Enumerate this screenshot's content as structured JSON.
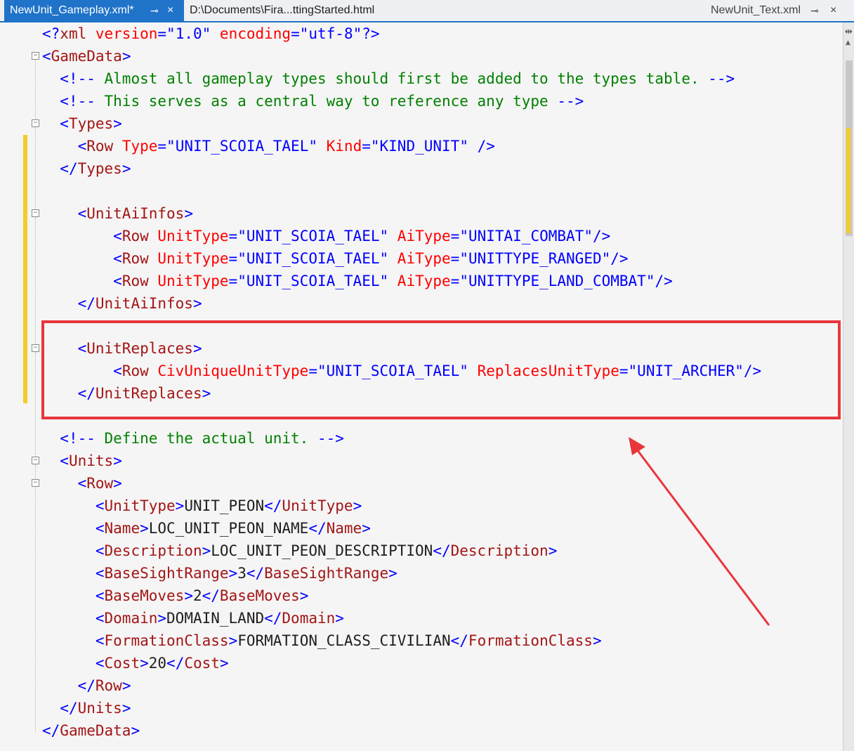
{
  "tabs": {
    "active": "NewUnit_Gameplay.xml*",
    "pin_icon": "⊸",
    "close_icon": "×",
    "second": "D:\\Documents\\Fira...ttingStarted.html",
    "right": "NewUnit_Text.xml"
  },
  "code": {
    "lines": [
      [
        [
          "p",
          "<?"
        ],
        [
          "t",
          "xml"
        ],
        [
          "a",
          " version"
        ],
        [
          "p",
          "=\""
        ],
        [
          "v",
          "1.0"
        ],
        [
          "p",
          "\""
        ],
        [
          "a",
          " encoding"
        ],
        [
          "p",
          "=\""
        ],
        [
          "v",
          "utf-8"
        ],
        [
          "p",
          "\"?>"
        ]
      ],
      [
        [
          "p",
          "<"
        ],
        [
          "t",
          "GameData"
        ],
        [
          "p",
          ">"
        ]
      ],
      [
        [
          "x",
          "  "
        ],
        [
          "p",
          "<!--"
        ],
        [
          "c",
          " Almost all gameplay types should first be added to the types table. "
        ],
        [
          "p",
          "-->"
        ]
      ],
      [
        [
          "x",
          "  "
        ],
        [
          "p",
          "<!--"
        ],
        [
          "c",
          " This serves as a central way to reference any type "
        ],
        [
          "p",
          "-->"
        ]
      ],
      [
        [
          "x",
          "  "
        ],
        [
          "p",
          "<"
        ],
        [
          "t",
          "Types"
        ],
        [
          "p",
          ">"
        ]
      ],
      [
        [
          "x",
          "    "
        ],
        [
          "p",
          "<"
        ],
        [
          "t",
          "Row"
        ],
        [
          "a",
          " Type"
        ],
        [
          "p",
          "=\""
        ],
        [
          "v",
          "UNIT_SCOIA_TAEL"
        ],
        [
          "p",
          "\""
        ],
        [
          "a",
          " Kind"
        ],
        [
          "p",
          "=\""
        ],
        [
          "v",
          "KIND_UNIT"
        ],
        [
          "p",
          "\" />"
        ]
      ],
      [
        [
          "x",
          "  "
        ],
        [
          "p",
          "</"
        ],
        [
          "t",
          "Types"
        ],
        [
          "p",
          ">"
        ]
      ],
      [],
      [
        [
          "x",
          "    "
        ],
        [
          "p",
          "<"
        ],
        [
          "t",
          "UnitAiInfos"
        ],
        [
          "p",
          ">"
        ]
      ],
      [
        [
          "x",
          "        "
        ],
        [
          "p",
          "<"
        ],
        [
          "t",
          "Row"
        ],
        [
          "a",
          " UnitType"
        ],
        [
          "p",
          "=\""
        ],
        [
          "v",
          "UNIT_SCOIA_TAEL"
        ],
        [
          "p",
          "\""
        ],
        [
          "a",
          " AiType"
        ],
        [
          "p",
          "=\""
        ],
        [
          "v",
          "UNITAI_COMBAT"
        ],
        [
          "p",
          "\"/>"
        ]
      ],
      [
        [
          "x",
          "        "
        ],
        [
          "p",
          "<"
        ],
        [
          "t",
          "Row"
        ],
        [
          "a",
          " UnitType"
        ],
        [
          "p",
          "=\""
        ],
        [
          "v",
          "UNIT_SCOIA_TAEL"
        ],
        [
          "p",
          "\""
        ],
        [
          "a",
          " AiType"
        ],
        [
          "p",
          "=\""
        ],
        [
          "v",
          "UNITTYPE_RANGED"
        ],
        [
          "p",
          "\"/>"
        ]
      ],
      [
        [
          "x",
          "        "
        ],
        [
          "p",
          "<"
        ],
        [
          "t",
          "Row"
        ],
        [
          "a",
          " UnitType"
        ],
        [
          "p",
          "=\""
        ],
        [
          "v",
          "UNIT_SCOIA_TAEL"
        ],
        [
          "p",
          "\""
        ],
        [
          "a",
          " AiType"
        ],
        [
          "p",
          "=\""
        ],
        [
          "v",
          "UNITTYPE_LAND_COMBAT"
        ],
        [
          "p",
          "\"/>"
        ]
      ],
      [
        [
          "x",
          "    "
        ],
        [
          "p",
          "</"
        ],
        [
          "t",
          "UnitAiInfos"
        ],
        [
          "p",
          ">"
        ]
      ],
      [],
      [
        [
          "x",
          "    "
        ],
        [
          "p",
          "<"
        ],
        [
          "t",
          "UnitReplaces"
        ],
        [
          "p",
          ">"
        ]
      ],
      [
        [
          "x",
          "        "
        ],
        [
          "p",
          "<"
        ],
        [
          "t",
          "Row"
        ],
        [
          "a",
          " CivUniqueUnitType"
        ],
        [
          "p",
          "=\""
        ],
        [
          "v",
          "UNIT_SCOIA_TAEL"
        ],
        [
          "p",
          "\""
        ],
        [
          "a",
          " ReplacesUnitType"
        ],
        [
          "p",
          "=\""
        ],
        [
          "v",
          "UNIT_ARCHER"
        ],
        [
          "p",
          "\"/>"
        ]
      ],
      [
        [
          "x",
          "    "
        ],
        [
          "p",
          "</"
        ],
        [
          "t",
          "UnitReplaces"
        ],
        [
          "p",
          ">"
        ]
      ],
      [],
      [
        [
          "x",
          "  "
        ],
        [
          "p",
          "<!--"
        ],
        [
          "c",
          " Define the actual unit. "
        ],
        [
          "p",
          "-->"
        ]
      ],
      [
        [
          "x",
          "  "
        ],
        [
          "p",
          "<"
        ],
        [
          "t",
          "Units"
        ],
        [
          "p",
          ">"
        ]
      ],
      [
        [
          "x",
          "    "
        ],
        [
          "p",
          "<"
        ],
        [
          "t",
          "Row"
        ],
        [
          "p",
          ">"
        ]
      ],
      [
        [
          "x",
          "      "
        ],
        [
          "p",
          "<"
        ],
        [
          "t",
          "UnitType"
        ],
        [
          "p",
          ">"
        ],
        [
          "x",
          "UNIT_PEON"
        ],
        [
          "p",
          "</"
        ],
        [
          "t",
          "UnitType"
        ],
        [
          "p",
          ">"
        ]
      ],
      [
        [
          "x",
          "      "
        ],
        [
          "p",
          "<"
        ],
        [
          "t",
          "Name"
        ],
        [
          "p",
          ">"
        ],
        [
          "x",
          "LOC_UNIT_PEON_NAME"
        ],
        [
          "p",
          "</"
        ],
        [
          "t",
          "Name"
        ],
        [
          "p",
          ">"
        ]
      ],
      [
        [
          "x",
          "      "
        ],
        [
          "p",
          "<"
        ],
        [
          "t",
          "Description"
        ],
        [
          "p",
          ">"
        ],
        [
          "x",
          "LOC_UNIT_PEON_DESCRIPTION"
        ],
        [
          "p",
          "</"
        ],
        [
          "t",
          "Description"
        ],
        [
          "p",
          ">"
        ]
      ],
      [
        [
          "x",
          "      "
        ],
        [
          "p",
          "<"
        ],
        [
          "t",
          "BaseSightRange"
        ],
        [
          "p",
          ">"
        ],
        [
          "x",
          "3"
        ],
        [
          "p",
          "</"
        ],
        [
          "t",
          "BaseSightRange"
        ],
        [
          "p",
          ">"
        ]
      ],
      [
        [
          "x",
          "      "
        ],
        [
          "p",
          "<"
        ],
        [
          "t",
          "BaseMoves"
        ],
        [
          "p",
          ">"
        ],
        [
          "x",
          "2"
        ],
        [
          "p",
          "</"
        ],
        [
          "t",
          "BaseMoves"
        ],
        [
          "p",
          ">"
        ]
      ],
      [
        [
          "x",
          "      "
        ],
        [
          "p",
          "<"
        ],
        [
          "t",
          "Domain"
        ],
        [
          "p",
          ">"
        ],
        [
          "x",
          "DOMAIN_LAND"
        ],
        [
          "p",
          "</"
        ],
        [
          "t",
          "Domain"
        ],
        [
          "p",
          ">"
        ]
      ],
      [
        [
          "x",
          "      "
        ],
        [
          "p",
          "<"
        ],
        [
          "t",
          "FormationClass"
        ],
        [
          "p",
          ">"
        ],
        [
          "x",
          "FORMATION_CLASS_CIVILIAN"
        ],
        [
          "p",
          "</"
        ],
        [
          "t",
          "FormationClass"
        ],
        [
          "p",
          ">"
        ]
      ],
      [
        [
          "x",
          "      "
        ],
        [
          "p",
          "<"
        ],
        [
          "t",
          "Cost"
        ],
        [
          "p",
          ">"
        ],
        [
          "x",
          "20"
        ],
        [
          "p",
          "</"
        ],
        [
          "t",
          "Cost"
        ],
        [
          "p",
          ">"
        ]
      ],
      [
        [
          "x",
          "    "
        ],
        [
          "p",
          "</"
        ],
        [
          "t",
          "Row"
        ],
        [
          "p",
          ">"
        ]
      ],
      [
        [
          "x",
          "  "
        ],
        [
          "p",
          "</"
        ],
        [
          "t",
          "Units"
        ],
        [
          "p",
          ">"
        ]
      ],
      [
        [
          "p",
          "</"
        ],
        [
          "t",
          "GameData"
        ],
        [
          "p",
          ">"
        ]
      ]
    ]
  },
  "colors": {
    "tag": "#a31515",
    "punct": "#0000ff",
    "attr": "#ff0000",
    "value": "#0000ff",
    "comment": "#008000",
    "annotation": "#e8363a",
    "change_bar": "#f2cc2a",
    "tab_active": "#1f73c8"
  },
  "icons": {
    "fold": "collapse-minus-icon",
    "arrow": "annotation-arrow"
  }
}
